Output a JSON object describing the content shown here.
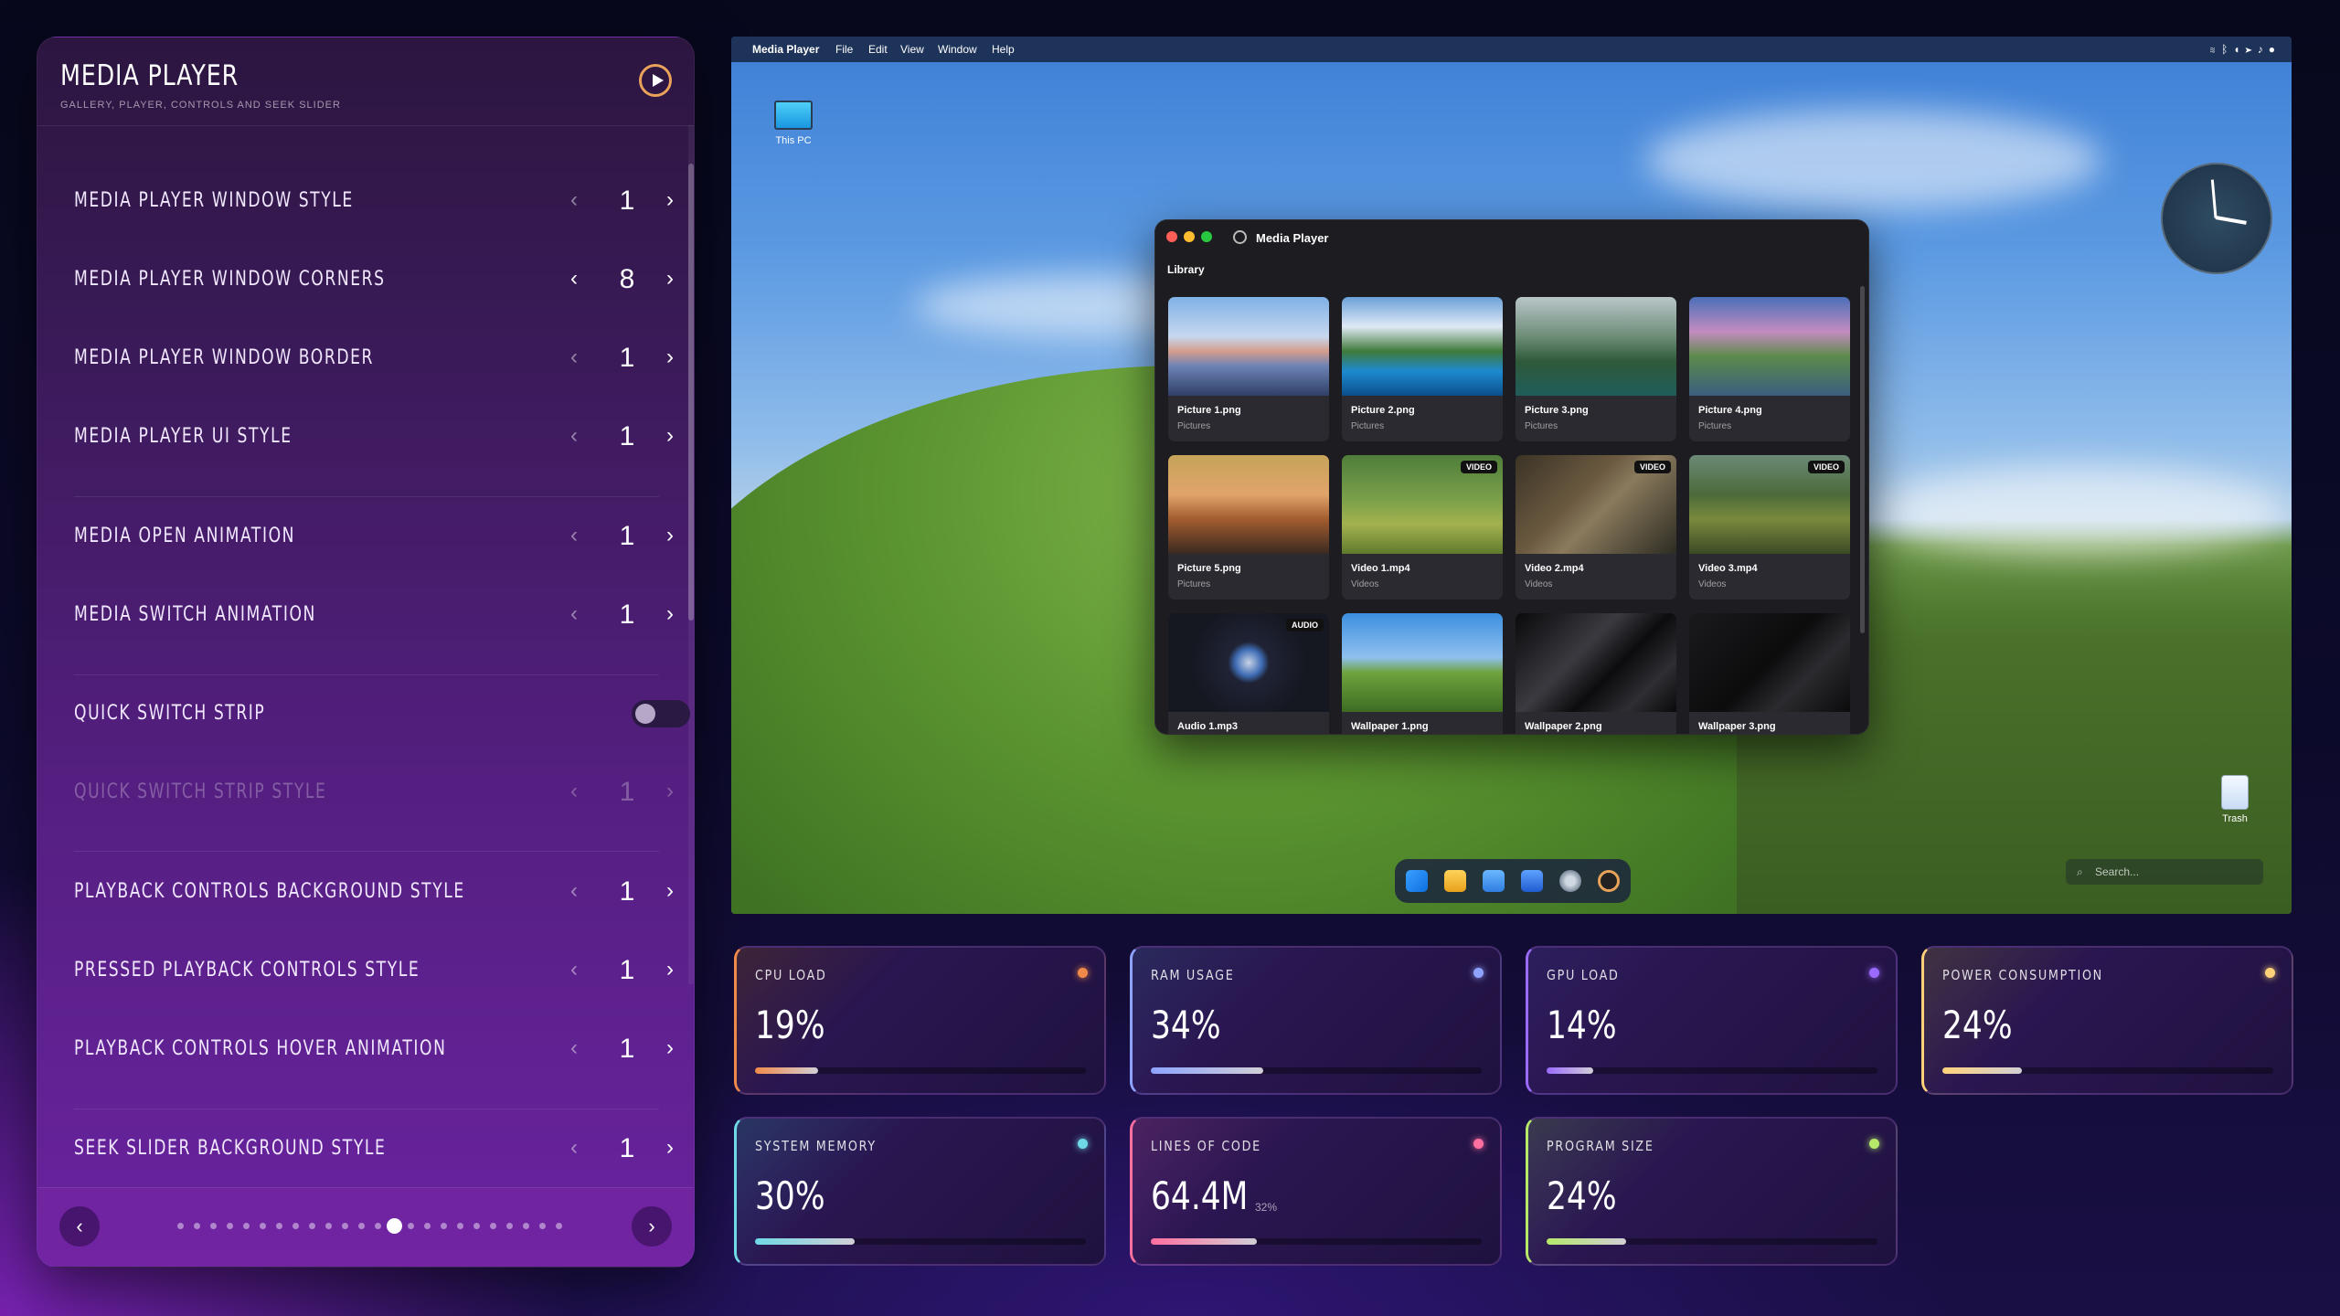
{
  "panel": {
    "title": "MEDIA PLAYER",
    "subtitle": "GALLERY, PLAYER, CONTROLS AND SEEK SLIDER",
    "settings": [
      {
        "label": "MEDIA PLAYER WINDOW STYLE",
        "value": "1"
      },
      {
        "label": "MEDIA PLAYER WINDOW CORNERS",
        "value": "8"
      },
      {
        "label": "MEDIA PLAYER WINDOW BORDER",
        "value": "1"
      },
      {
        "label": "MEDIA PLAYER UI STYLE",
        "value": "1"
      },
      {
        "label": "MEDIA OPEN ANIMATION",
        "value": "1"
      },
      {
        "label": "MEDIA SWITCH ANIMATION",
        "value": "1"
      },
      {
        "label": "QUICK SWITCH STRIP",
        "toggle": false
      },
      {
        "label": "QUICK SWITCH STRIP STYLE",
        "value": "1",
        "disabled": true
      },
      {
        "label": "PLAYBACK CONTROLS BACKGROUND STYLE",
        "value": "1"
      },
      {
        "label": "PRESSED PLAYBACK CONTROLS STYLE",
        "value": "1"
      },
      {
        "label": "PLAYBACK CONTROLS HOVER ANIMATION",
        "value": "1"
      },
      {
        "label": "SEEK SLIDER BACKGROUND STYLE",
        "value": "1"
      }
    ],
    "arrows": {
      "prev": "‹",
      "next": "›"
    },
    "pagination": {
      "total": 24,
      "active": 13
    }
  },
  "desktop": {
    "menubar": [
      "Media Player",
      "File",
      "Edit",
      "View",
      "Window",
      "Help"
    ],
    "tray_icons": [
      "wifi-icon",
      "bluetooth-icon",
      "volume-icon",
      "location-icon",
      "bell-icon",
      "user-icon"
    ],
    "icons": {
      "this_pc": "This PC",
      "trash": "Trash"
    },
    "search_placeholder": "Search...",
    "clock": {
      "hour_hand_deg": 10,
      "minute_hand_deg": -95
    },
    "taskbar": [
      "windows-start-icon",
      "folder-icon",
      "notes-icon",
      "calendar-icon",
      "settings-icon",
      "media-player-icon"
    ]
  },
  "media_window": {
    "title": "Media Player",
    "section": "Library",
    "items": [
      {
        "name": "Picture 1.png",
        "category": "Pictures",
        "badge": ""
      },
      {
        "name": "Picture 2.png",
        "category": "Pictures",
        "badge": ""
      },
      {
        "name": "Picture 3.png",
        "category": "Pictures",
        "badge": ""
      },
      {
        "name": "Picture 4.png",
        "category": "Pictures",
        "badge": ""
      },
      {
        "name": "Picture 5.png",
        "category": "Pictures",
        "badge": ""
      },
      {
        "name": "Video 1.mp4",
        "category": "Videos",
        "badge": "VIDEO"
      },
      {
        "name": "Video 2.mp4",
        "category": "Videos",
        "badge": "VIDEO"
      },
      {
        "name": "Video 3.mp4",
        "category": "Videos",
        "badge": "VIDEO"
      },
      {
        "name": "Audio 1.mp3",
        "category": "",
        "badge": "AUDIO"
      },
      {
        "name": "Wallpaper 1.png",
        "category": "",
        "badge": ""
      },
      {
        "name": "Wallpaper 2.png",
        "category": "",
        "badge": ""
      },
      {
        "name": "Wallpaper 3.png",
        "category": "",
        "badge": ""
      }
    ]
  },
  "stats": [
    {
      "label": "CPU LOAD",
      "value": "19%",
      "fraction": 0.19,
      "color": "#f08a4b"
    },
    {
      "label": "RAM USAGE",
      "value": "34%",
      "fraction": 0.34,
      "color": "#8ea3ff"
    },
    {
      "label": "GPU LOAD",
      "value": "14%",
      "fraction": 0.14,
      "color": "#9b6bff"
    },
    {
      "label": "POWER CONSUMPTION",
      "value": "24%",
      "fraction": 0.24,
      "color": "#ffd27a"
    },
    {
      "label": "SYSTEM MEMORY",
      "value": "30%",
      "fraction": 0.3,
      "color": "#6fd9e6"
    },
    {
      "label": "LINES OF CODE",
      "value": "64.4M",
      "sub": "32%",
      "fraction": 0.32,
      "color": "#ff6fa0"
    },
    {
      "label": "PROGRAM SIZE",
      "value": "24%",
      "fraction": 0.24,
      "color": "#b6e86a"
    }
  ]
}
